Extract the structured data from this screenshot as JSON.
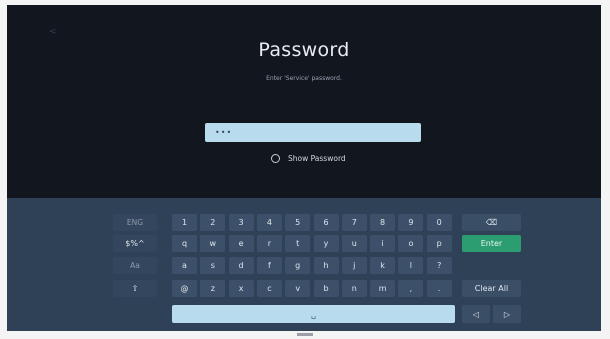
{
  "screen": {
    "back_indicator": "<",
    "title": "Password",
    "subtitle": "Enter 'Service' password.",
    "password_value": "•••",
    "show_password_label": "Show Password"
  },
  "keyboard": {
    "side_keys": [
      "ENG",
      "$%^",
      "Aa",
      "⇧"
    ],
    "rows": [
      [
        "1",
        "2",
        "3",
        "4",
        "5",
        "6",
        "7",
        "8",
        "9",
        "0"
      ],
      [
        "q",
        "w",
        "e",
        "r",
        "t",
        "y",
        "u",
        "i",
        "o",
        "p"
      ],
      [
        "a",
        "s",
        "d",
        "f",
        "g",
        "h",
        "j",
        "k",
        "l",
        "?"
      ],
      [
        "@",
        "z",
        "x",
        "c",
        "v",
        "b",
        "n",
        "m",
        ",",
        "."
      ]
    ],
    "backspace_label": "⌫",
    "enter_label": "Enter",
    "clear_all_label": "Clear All",
    "space_label": "␣",
    "cursor_left_label": "◁",
    "cursor_right_label": "▷"
  },
  "colors": {
    "screen_bg": "#11161f",
    "keyboard_bg": "#2f4157",
    "input_bg": "#b8dcee",
    "enter_green": "#2c9d71"
  }
}
